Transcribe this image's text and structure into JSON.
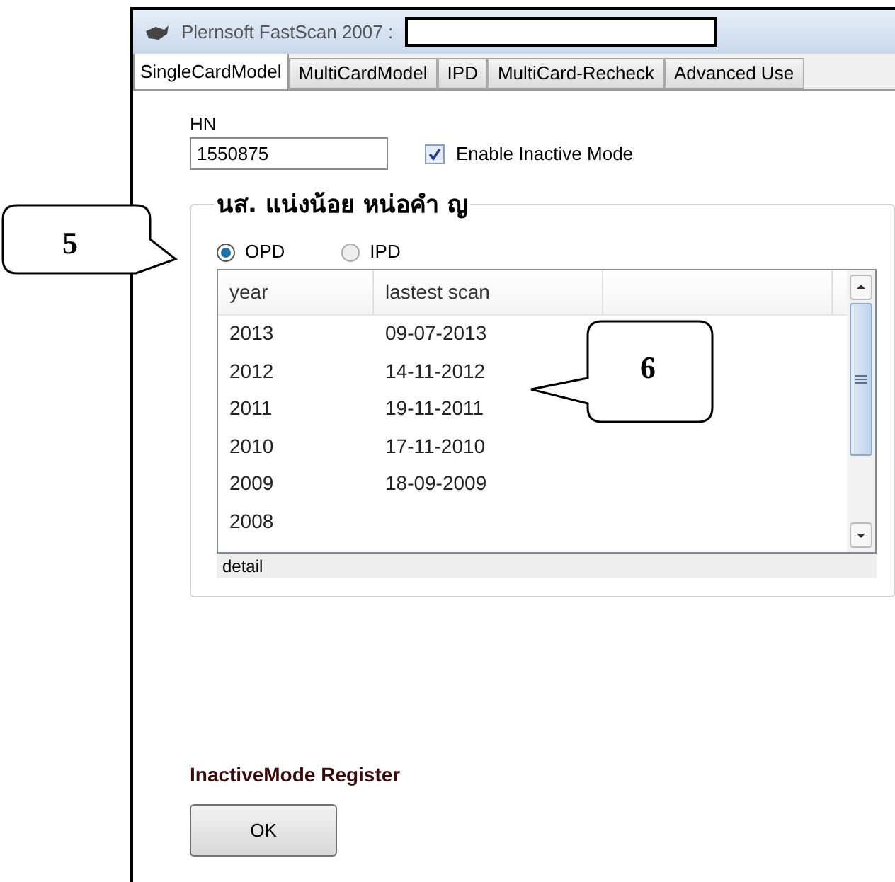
{
  "window": {
    "title": "Plernsoft FastScan 2007 :"
  },
  "tabs": [
    {
      "label": "SingleCardModel",
      "selected": true
    },
    {
      "label": "MultiCardModel",
      "selected": false
    },
    {
      "label": "IPD",
      "selected": false
    },
    {
      "label": "MultiCard-Recheck",
      "selected": false
    },
    {
      "label": "Advanced Use",
      "selected": false
    }
  ],
  "hn": {
    "label": "HN",
    "value": "1550875"
  },
  "enable_inactive": {
    "label": "Enable Inactive Mode",
    "checked": true
  },
  "patient_group": {
    "title": "นส. แน่งน้อย หน่อคำ ญ",
    "radios": [
      {
        "label": "OPD",
        "selected": true
      },
      {
        "label": "IPD",
        "selected": false
      }
    ],
    "table": {
      "columns": [
        "year",
        "lastest scan"
      ],
      "rows": [
        [
          "2013",
          "09-07-2013"
        ],
        [
          "2012",
          "14-11-2012"
        ],
        [
          "2011",
          "19-11-2011"
        ],
        [
          "2010",
          "17-11-2010"
        ],
        [
          "2009",
          "18-09-2009"
        ],
        [
          "2008",
          ""
        ]
      ]
    },
    "footer": "detail"
  },
  "register_label": "InactiveMode Register",
  "ok_button": "OK",
  "callouts": [
    {
      "label": "5"
    },
    {
      "label": "6"
    }
  ]
}
